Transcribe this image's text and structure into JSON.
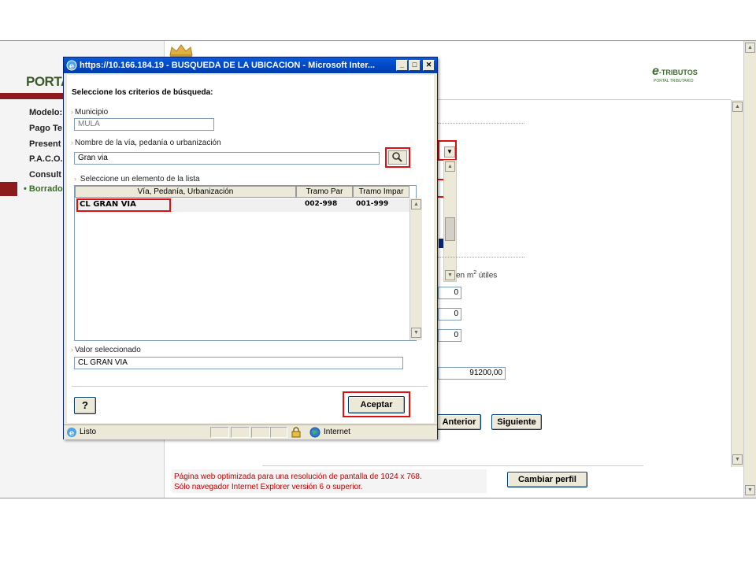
{
  "background": {
    "logo_text": "PORTA",
    "menu": [
      "Modelo:",
      "Pago Te",
      "Present",
      "P.A.C.O.",
      "Consult"
    ],
    "active_menu": "• Borrado",
    "brand": {
      "prefix": "e",
      "suffix": "-TRIBUTOS",
      "tagline": "PORTAL TRIBUTARIO"
    },
    "area_label_prefix": "en m",
    "area_label_sup": "2",
    "area_label_suffix": " útiles",
    "fields": [
      "0",
      "0",
      "0",
      "91200,00"
    ],
    "btn_prev": "Anterior",
    "btn_next": "Siguiente",
    "footer_line1": "Página web optimizada para una resolución de pantalla de 1024 x 768.",
    "footer_line2": "Sólo navegador Internet Explorer versión 6 o superior.",
    "btn_profile": "Cambiar perfil"
  },
  "popup": {
    "title": "https://10.166.184.19 - BUSQUEDA DE LA UBICACION - Microsoft Inter...",
    "heading": "Seleccione los criterios de búsqueda:",
    "municipio_label": "Municipio",
    "municipio_value": "MULA",
    "via_label": "Nombre de la vía, pedanía o urbanización",
    "via_value": "Gran via",
    "list_label": "Seleccione un elemento de la lista",
    "columns": [
      "Vía, Pedanía, Urbanización",
      "Tramo Par",
      "Tramo Impar"
    ],
    "rows": [
      {
        "name": "CL GRAN VIA",
        "par": "002-998",
        "impar": "001-999"
      }
    ],
    "selected_label": "Valor seleccionado",
    "selected_value": "CL GRAN VIA",
    "help_button": "?",
    "accept_button": "Aceptar",
    "status_text": "Listo",
    "zone_text": "Internet",
    "colors": {
      "titlebar": "#0146c3",
      "highlight_red": "#dd1111",
      "accent_green": "#3b6b2b"
    }
  }
}
